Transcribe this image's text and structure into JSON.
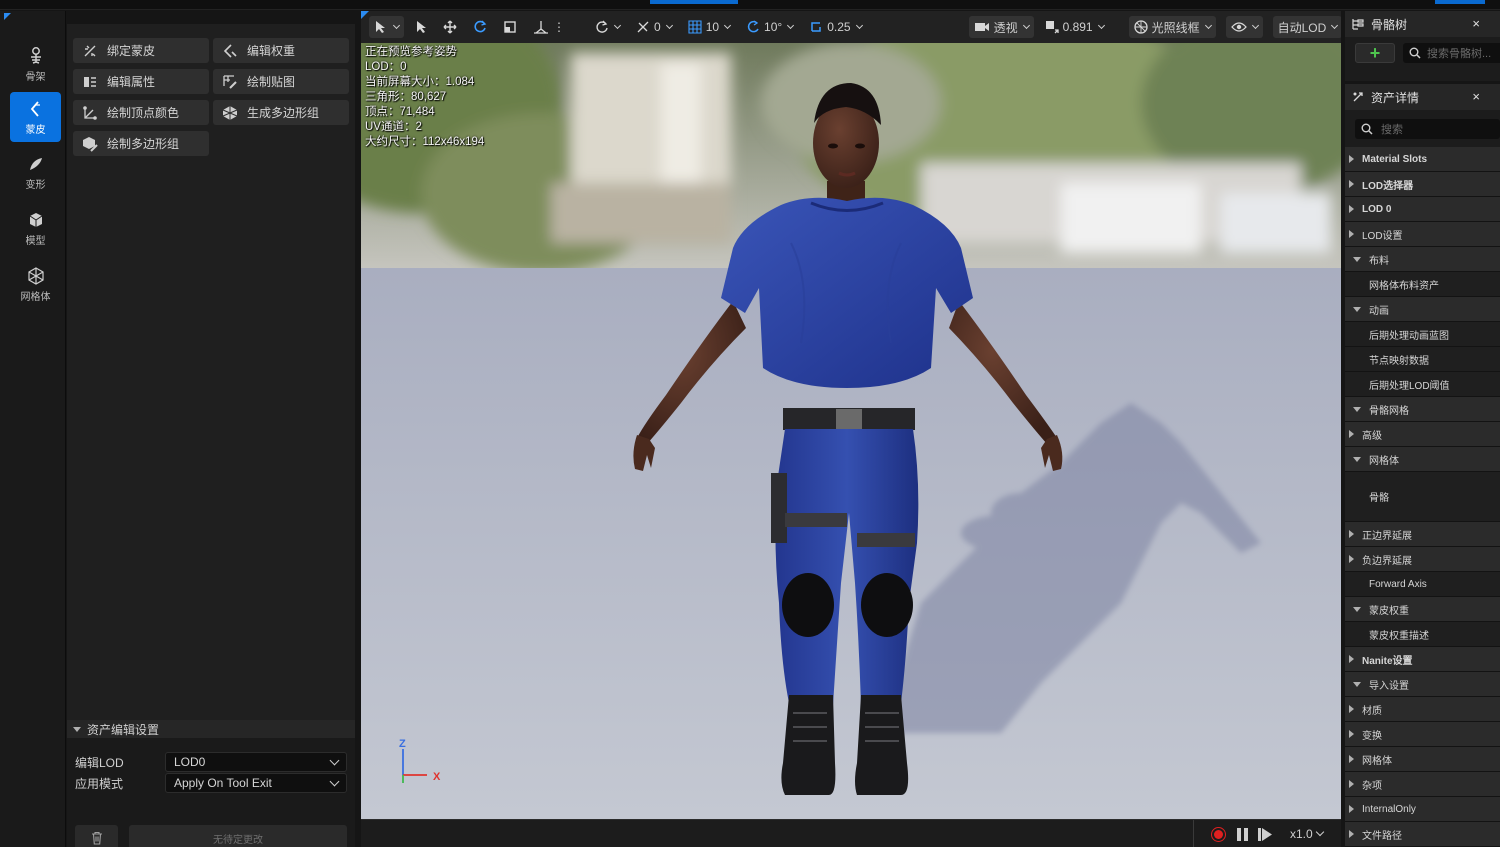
{
  "left_modes": [
    {
      "id": "skeleton",
      "label": "骨架"
    },
    {
      "id": "skin",
      "label": "蒙皮"
    },
    {
      "id": "deform",
      "label": "变形"
    },
    {
      "id": "model",
      "label": "模型"
    },
    {
      "id": "mesh",
      "label": "网格体"
    }
  ],
  "tools": [
    "绑定蒙皮",
    "编辑权重",
    "编辑属性",
    "绘制贴图",
    "绘制顶点颜色",
    "生成多边形组",
    "绘制多边形组"
  ],
  "asset_settings": {
    "header": "资产编辑设置",
    "edit_lod_label": "编辑LOD",
    "edit_lod_value": "LOD0",
    "apply_mode_label": "应用模式",
    "apply_mode_value": "Apply On Tool Exit",
    "no_pending_label": "无待定更改"
  },
  "viewport_toolbar": {
    "rotate_snap": "0",
    "grid_snap": "10",
    "angle_snap": "10°",
    "scale_snap": "0.25",
    "view_mode": "透视",
    "screen_size": "0.891",
    "lighting_mode": "光照线框",
    "lod_mode": "自动LOD"
  },
  "stats": [
    "正在预览参考姿势",
    "LOD：0",
    "当前屏幕大小：1.084",
    "三角形：80,627",
    "顶点：71,484",
    "UV通道：2",
    "大约尺寸：112x46x194"
  ],
  "axes": {
    "x": "X",
    "z": "Z"
  },
  "playback": {
    "speed": "x1.0"
  },
  "skeleton_tree": {
    "title": "骨骼树",
    "search_placeholder": "搜索骨骼树..."
  },
  "asset_details": {
    "title": "资产详情",
    "search_placeholder": "搜索",
    "rows": [
      {
        "label": "Material Slots",
        "kind": "cat",
        "state": "collapsed",
        "bold": true
      },
      {
        "label": "LOD选择器",
        "kind": "cat",
        "state": "collapsed",
        "bold": true
      },
      {
        "label": "LOD 0",
        "kind": "cat",
        "state": "collapsed",
        "bold": true
      },
      {
        "label": "LOD设置",
        "kind": "cat",
        "state": "collapsed"
      },
      {
        "label": "布料",
        "kind": "cat",
        "state": "expanded"
      },
      {
        "label": "网格体布料资产",
        "kind": "sub"
      },
      {
        "label": "动画",
        "kind": "cat",
        "state": "expanded"
      },
      {
        "label": "后期处理动画蓝图",
        "kind": "sub"
      },
      {
        "label": "节点映射数据",
        "kind": "sub"
      },
      {
        "label": "后期处理LOD阈值",
        "kind": "sub"
      },
      {
        "label": "骨骼网格",
        "kind": "cat",
        "state": "expanded"
      },
      {
        "label": "高级",
        "kind": "cat",
        "state": "collapsed"
      },
      {
        "label": "网格体",
        "kind": "cat",
        "state": "expanded"
      },
      {
        "label": "骨骼",
        "kind": "sub",
        "tall": true
      },
      {
        "label": "正边界延展",
        "kind": "cat",
        "state": "collapsed"
      },
      {
        "label": "负边界延展",
        "kind": "cat",
        "state": "collapsed"
      },
      {
        "label": "Forward Axis",
        "kind": "sub"
      },
      {
        "label": "蒙皮权重",
        "kind": "cat",
        "state": "expanded"
      },
      {
        "label": "蒙皮权重描述",
        "kind": "sub"
      },
      {
        "label": "Nanite设置",
        "kind": "cat",
        "state": "collapsed",
        "bold": true
      },
      {
        "label": "导入设置",
        "kind": "cat",
        "state": "expanded"
      },
      {
        "label": "材质",
        "kind": "cat",
        "state": "collapsed"
      },
      {
        "label": "变换",
        "kind": "cat",
        "state": "collapsed"
      },
      {
        "label": "网格体",
        "kind": "cat",
        "state": "collapsed"
      },
      {
        "label": "杂项",
        "kind": "cat",
        "state": "collapsed"
      },
      {
        "label": "InternalOnly",
        "kind": "cat",
        "state": "collapsed"
      },
      {
        "label": "文件路径",
        "kind": "cat",
        "state": "collapsed"
      }
    ]
  },
  "colors": {
    "accent": "#0a72e0",
    "panel": "#1f1f1f",
    "record": "#e02020"
  }
}
